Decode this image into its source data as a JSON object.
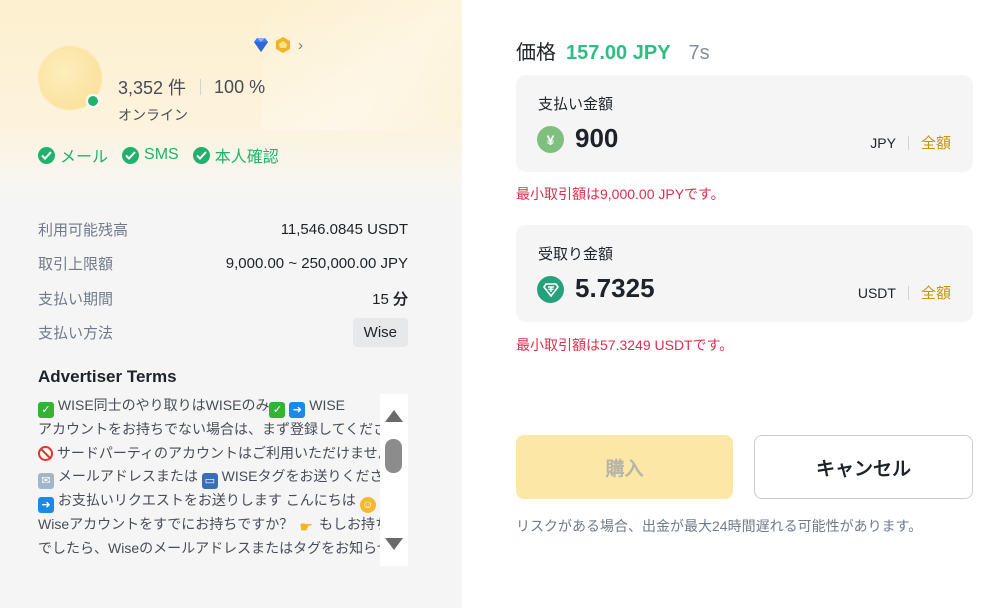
{
  "advertiser": {
    "orders": "3,352 件",
    "completion": "100 %",
    "status": "オンライン",
    "badges": [
      "diamond-icon",
      "medal-icon",
      "chevron-right-icon"
    ],
    "verifications": [
      "メール",
      "SMS",
      "本人確認"
    ]
  },
  "info": [
    {
      "label": "利用可能残高",
      "value": "11,546.0845 USDT"
    },
    {
      "label": "取引上限額",
      "value": "9,000.00 ~ 250,000.00 JPY"
    },
    {
      "label": "支払い期間",
      "value": "15",
      "unit": "分"
    },
    {
      "label": "支払い方法",
      "value": "Wise"
    }
  ],
  "terms": {
    "title": "Advertiser Terms",
    "lines": [
      "WISE同士のやり取りはWISEのみ",
      "WISE",
      "アカウントをお持ちでない場合は、まず登録してください",
      "サードパーティのアカウントはご利用いただけません",
      "メールアドレスまたは",
      "WISEタグをお送りください",
      "お支払いリクエストをお送りします こんにちは",
      "Wiseアカウントをすでにお持ちですか？",
      "もしお持ち",
      "でしたら、Wiseのメールアドレスまたはタグをお知らせくだ"
    ]
  },
  "price": {
    "label": "価格",
    "value": "157.00 JPY",
    "timer": "7s"
  },
  "pay": {
    "label": "支払い金額",
    "icon": "yen-icon",
    "symbol": "¥",
    "value": "900",
    "currency": "JPY",
    "all_label": "全額",
    "error": "最小取引額は9,000.00 JPYです。"
  },
  "receive": {
    "label": "受取り金額",
    "icon": "tether-icon",
    "value": "5.7325",
    "currency": "USDT",
    "all_label": "全額",
    "error": "最小取引額は57.3249 USDTです。"
  },
  "actions": {
    "buy": "購入",
    "cancel": "キャンセル"
  },
  "risk_note": "リスクがある場合、出金が最大24時間遅れる可能性があります。",
  "colors": {
    "green": "#2ebd85",
    "gold": "#c99400",
    "error": "#d9304e",
    "buy_disabled": "#fce7a6"
  }
}
